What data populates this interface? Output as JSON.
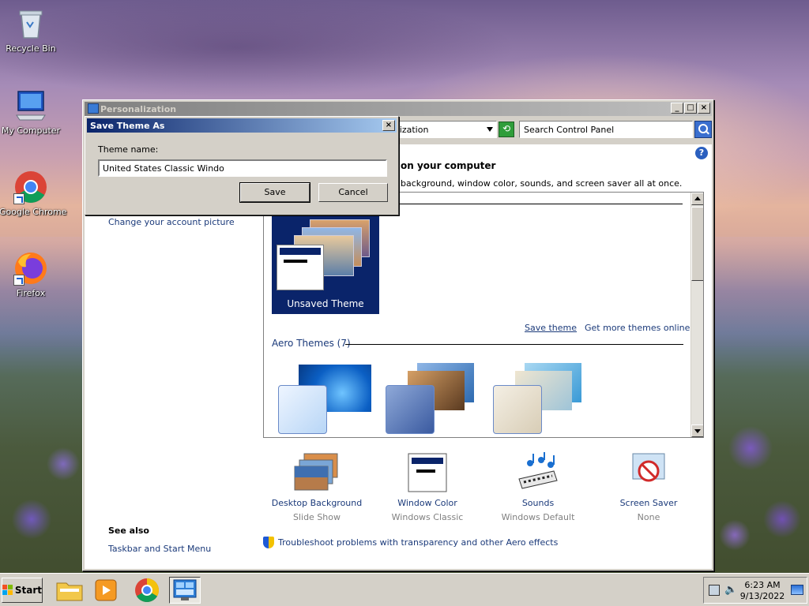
{
  "desktop": {
    "icons": [
      {
        "label": "Recycle Bin"
      },
      {
        "label": "My Computer"
      },
      {
        "label": "Google Chrome"
      },
      {
        "label": "Firefox"
      }
    ]
  },
  "window": {
    "title": "Personalization",
    "address_text": "alization",
    "search_placeholder": "Search Control Panel",
    "heading": "on your computer",
    "subheading": "background, window color, sounds, and screen saver all at once.",
    "left_links": {
      "account_picture": "Change your account picture"
    },
    "see_also": {
      "title": "See also",
      "taskbar_link": "Taskbar and Start Menu"
    },
    "themes": {
      "unsaved_label": "Unsaved Theme",
      "save_theme_link": "Save theme",
      "get_more_link": "Get more themes online",
      "aero_label": "Aero Themes (7)"
    },
    "bottom_items": [
      {
        "label": "Desktop Background",
        "sub": "Slide Show"
      },
      {
        "label": "Window Color",
        "sub": "Windows Classic"
      },
      {
        "label": "Sounds",
        "sub": "Windows Default"
      },
      {
        "label": "Screen Saver",
        "sub": "None"
      }
    ],
    "troubleshoot_link": "Troubleshoot problems with transparency and other Aero effects"
  },
  "dialog": {
    "title": "Save Theme As",
    "field_label": "Theme name:",
    "field_value": "United States Classic Windo",
    "save_label": "Save",
    "cancel_label": "Cancel"
  },
  "taskbar": {
    "start_label": "Start",
    "time": "6:23 AM",
    "date": "9/13/2022"
  }
}
